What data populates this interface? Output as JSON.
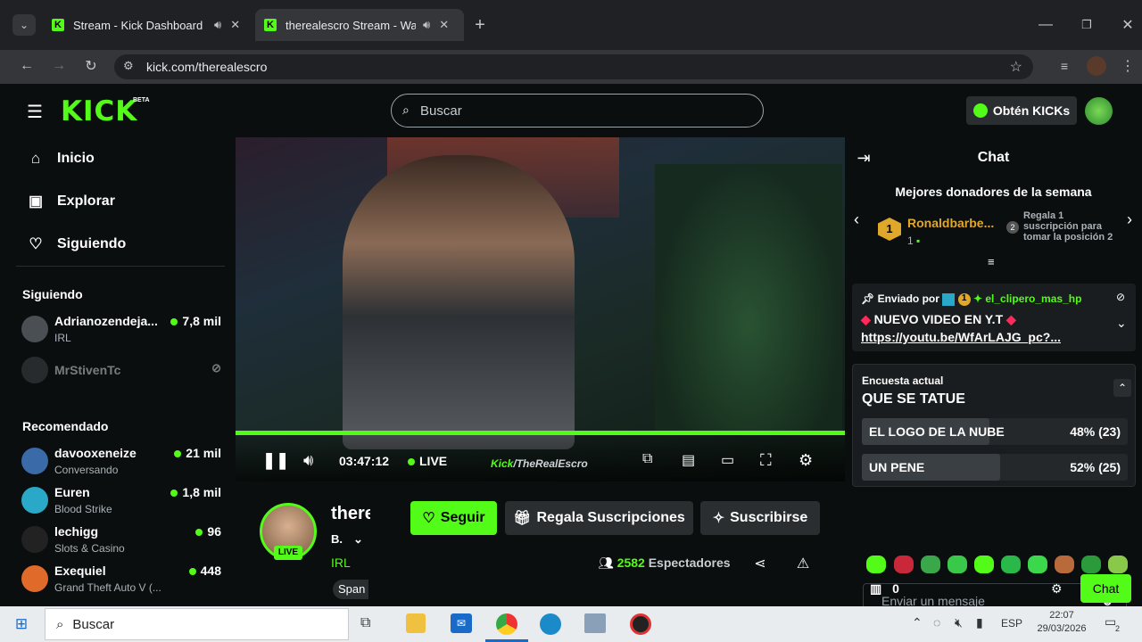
{
  "browser": {
    "tabs": [
      {
        "title": "Stream - Kick Dashboard"
      },
      {
        "title": "therealescro Stream - Watc"
      }
    ],
    "url": "kick.com/therealescro"
  },
  "header": {
    "logo": "KICK",
    "beta": "BETA",
    "search_placeholder": "Buscar",
    "kicks_label": "Obtén KICKs"
  },
  "nav": [
    {
      "label": "Inicio",
      "icon": "home-icon"
    },
    {
      "label": "Explorar",
      "icon": "explore-icon"
    },
    {
      "label": "Siguiendo",
      "icon": "heart-icon"
    }
  ],
  "following": {
    "title": "Siguiendo",
    "items": [
      {
        "name": "Adrianozendeja...",
        "sub": "IRL",
        "viewers": "7,8 mil"
      },
      {
        "name": "MrStivenTc",
        "sub": "",
        "viewers": ""
      }
    ]
  },
  "recommended": {
    "title": "Recomendado",
    "items": [
      {
        "name": "davooxeneize",
        "sub": "Conversando",
        "viewers": "21 mil",
        "color": "#3a6aa8"
      },
      {
        "name": "Euren",
        "sub": "Blood Strike",
        "viewers": "1,8 mil",
        "color": "#2aa8c8"
      },
      {
        "name": "lechigg",
        "sub": "Slots & Casino",
        "viewers": "96",
        "color": "#222222"
      },
      {
        "name": "Exequiel",
        "sub": "Grand Theft Auto V (...",
        "viewers": "448",
        "color": "#e06a2a"
      }
    ]
  },
  "player": {
    "time": "03:47:12",
    "live": "LIVE",
    "watermark": "/TheRealEscro",
    "progress": 1.0
  },
  "channel": {
    "name": "there",
    "badge": "B.",
    "category": "IRL",
    "language": "Span",
    "live": "LIVE",
    "follow": "Seguir",
    "gift": "Regala Suscripciones",
    "subscribe": "Suscribirse",
    "viewers": "2582",
    "viewers_label": "Espectadores"
  },
  "chat": {
    "title": "Chat",
    "donors_title": "Mejores donadores de la semana",
    "donor_rank": "1",
    "donor_name": "Ronaldbarbe...",
    "donor_count": "1",
    "gift_text": "Regala 1 suscripción para tomar la posición 2",
    "gift_rank": "2",
    "pinned": {
      "label": "Enviado por",
      "user": "el_clipero_mas_hp",
      "badge_num": "1",
      "message": "NUEVO VIDEO EN Y.T",
      "link": "https://youtu.be/WfArLAJG_pc?..."
    },
    "poll": {
      "label": "Encuesta actual",
      "question": "QUE SE TATUE",
      "options": [
        {
          "text": "EL LOGO DE LA NUBE",
          "pct": "48% (23)",
          "ratio": 0.48
        },
        {
          "text": "UN PENE",
          "pct": "52% (25)",
          "ratio": 0.52
        }
      ]
    },
    "input_placeholder": "Enviar un mensaje",
    "kicks_count": "0",
    "send": "Chat"
  },
  "taskbar": {
    "search": "Buscar",
    "lang": "ESP",
    "time": "22:07",
    "date": "29/03/2026",
    "notif": "2"
  }
}
